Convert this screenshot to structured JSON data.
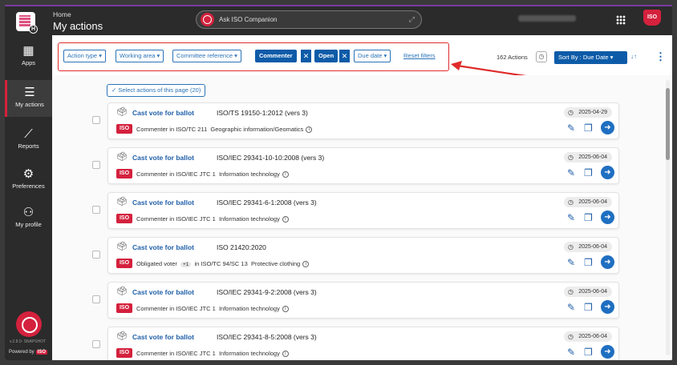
{
  "header": {
    "breadcrumb": "Home",
    "title": "My actions",
    "companion_label": "Ask ISO Companion",
    "iso_badge": "ISO"
  },
  "sidebar": {
    "items": [
      {
        "label": "Apps",
        "icon": "apps-grid-icon"
      },
      {
        "label": "My actions",
        "icon": "checklist-icon"
      },
      {
        "label": "Reports",
        "icon": "chart-icon"
      },
      {
        "label": "Preferences",
        "icon": "gear-icon"
      },
      {
        "label": "My profile",
        "icon": "person-icon"
      }
    ],
    "version": "v.2.8.0-\nSNAPSHOT",
    "powered_by": "Powered by",
    "powered_badge": "ISO"
  },
  "filters": {
    "action_type": "Action type ▾",
    "working_area": "Working area ▾",
    "committee_reference": "Committee reference ▾",
    "commenter": "Commenter",
    "open": "Open",
    "due_date": "Due date ▾",
    "reset": "Reset filters",
    "clear_symbol": "✕"
  },
  "toolbar": {
    "count": "162 Actions",
    "sort_label": "Sort By : Due Date",
    "sort_caret": "▾",
    "sort_order": "↓↑",
    "kebab": "⋮"
  },
  "select_page": "Select actions of this page (20)",
  "actions": [
    {
      "action": "Cast vote for ballot",
      "reference": "ISO/TS 19150-1:2012 (vers 3)",
      "org": "ISO",
      "role": "Commenter",
      "committee": "ISO/TC 211",
      "area": "Geographic information/Geomatics",
      "due": "2025-04-29",
      "plus": ""
    },
    {
      "action": "Cast vote for ballot",
      "reference": "ISO/IEC 29341-10-10:2008 (vers 3)",
      "org": "ISO",
      "role": "Commenter",
      "committee": "ISO/IEC JTC 1",
      "area": "Information technology",
      "due": "2025-06-04",
      "plus": ""
    },
    {
      "action": "Cast vote for ballot",
      "reference": "ISO/IEC 29341-6-1:2008 (vers 3)",
      "org": "ISO",
      "role": "Commenter",
      "committee": "ISO/IEC JTC 1",
      "area": "Information technology",
      "due": "2025-06-04",
      "plus": ""
    },
    {
      "action": "Cast vote for ballot",
      "reference": "ISO 21420:2020",
      "org": "ISO",
      "role": "Obligated voter",
      "committee": "ISO/TC 94/SC 13",
      "area": "Protective clothing",
      "due": "2025-06-04",
      "plus": "+1"
    },
    {
      "action": "Cast vote for ballot",
      "reference": "ISO/IEC 29341-9-2:2008 (vers 3)",
      "org": "ISO",
      "role": "Commenter",
      "committee": "ISO/IEC JTC 1",
      "area": "Information technology",
      "due": "2025-06-04",
      "plus": ""
    },
    {
      "action": "Cast vote for ballot",
      "reference": "ISO/IEC 29341-8-5:2008 (vers 3)",
      "org": "ISO",
      "role": "Commenter",
      "committee": "ISO/IEC JTC 1",
      "area": "Information technology",
      "due": "2025-06-04",
      "plus": ""
    }
  ],
  "colors": {
    "accent": "#0d5ba8",
    "brand": "#d4213d",
    "highlight": "#e02b2b"
  }
}
